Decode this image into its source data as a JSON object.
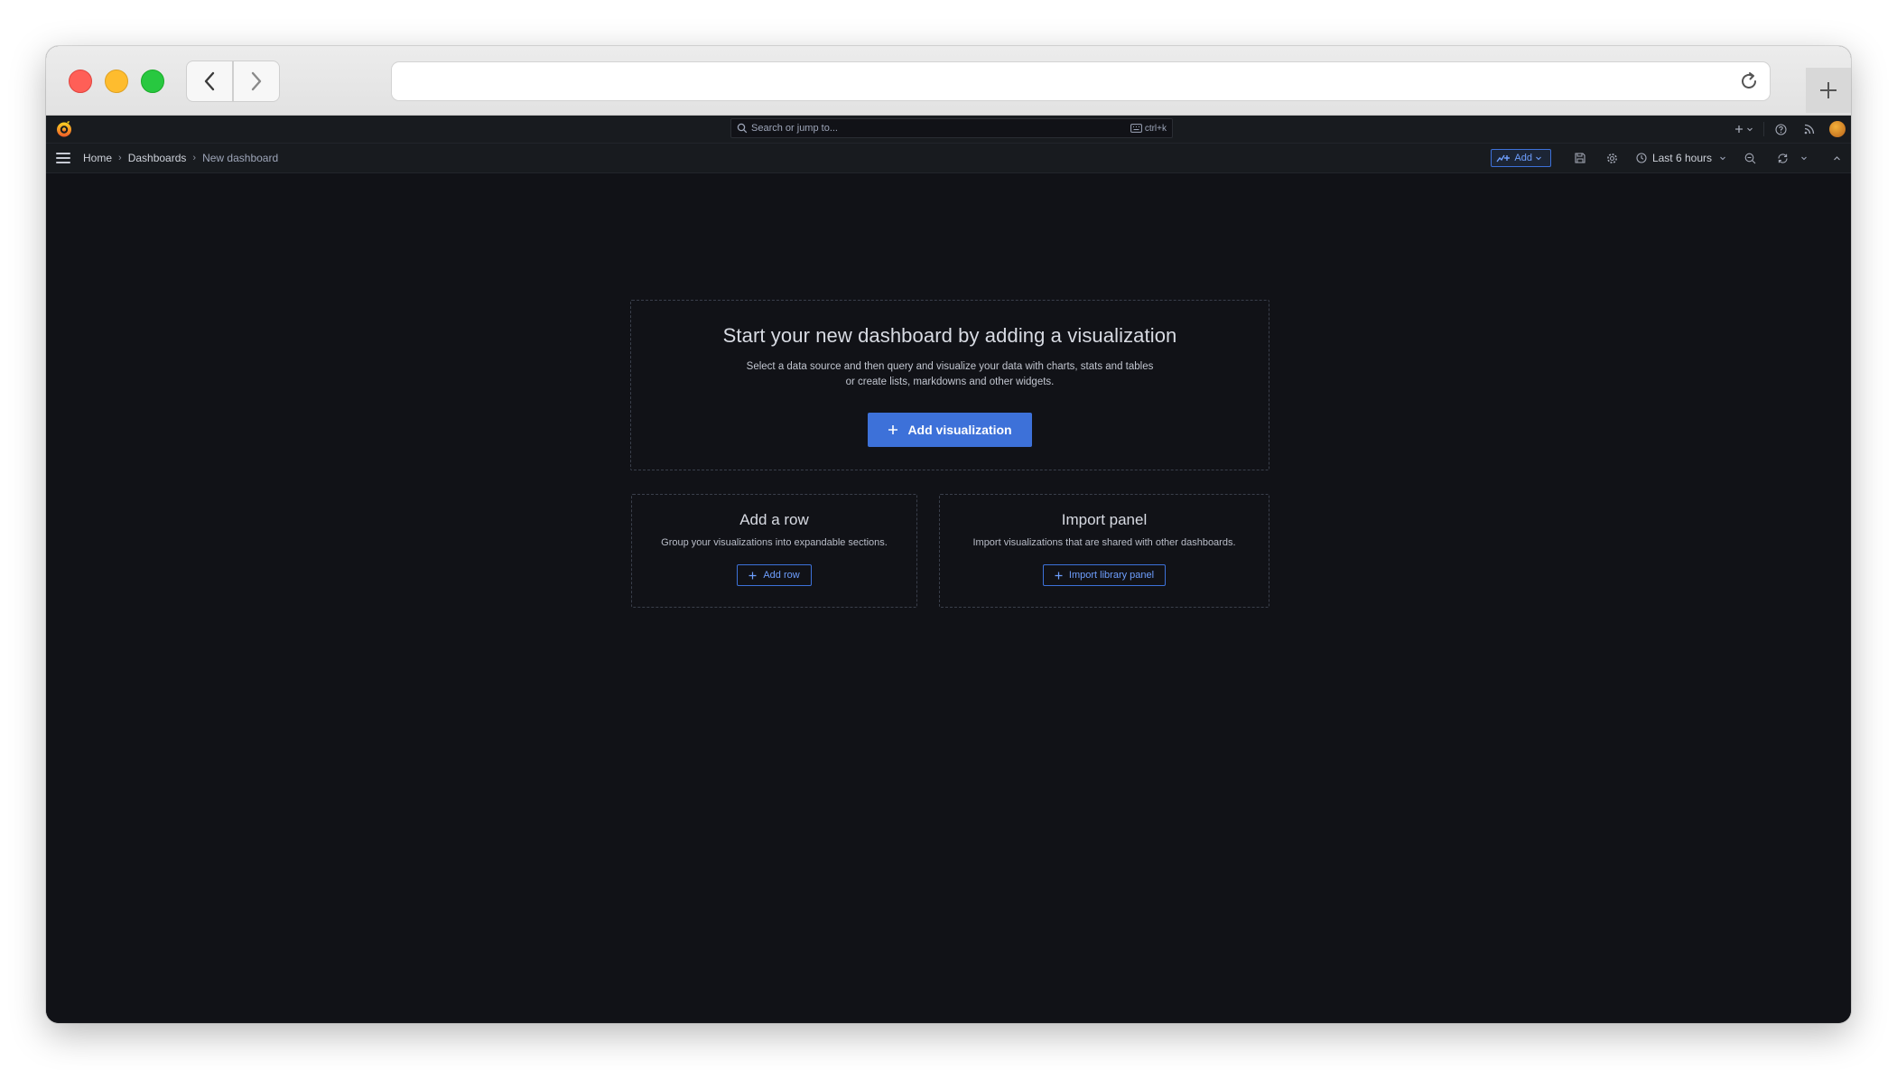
{
  "browser": {
    "url": ""
  },
  "topbar": {
    "search_placeholder": "Search or jump to...",
    "shortcut": "ctrl+k"
  },
  "breadcrumb": {
    "items": [
      "Home",
      "Dashboards"
    ],
    "current": "New dashboard"
  },
  "toolbar": {
    "add_label": "Add",
    "time_range": "Last 6 hours"
  },
  "main": {
    "title": "Start your new dashboard by adding a visualization",
    "description_line1": "Select a data source and then query and visualize your data with charts, stats and tables",
    "description_line2": "or create lists, markdowns and other widgets.",
    "add_visualization_label": "Add visualization",
    "row_card": {
      "title": "Add a row",
      "description": "Group your visualizations into expandable sections.",
      "button": "Add row"
    },
    "import_card": {
      "title": "Import panel",
      "description": "Import visualizations that are shared with other dashboards.",
      "button": "Import library panel"
    }
  },
  "colors": {
    "background": "#111217",
    "primary": "#3d71d9",
    "primary_text": "#6e9fff"
  }
}
